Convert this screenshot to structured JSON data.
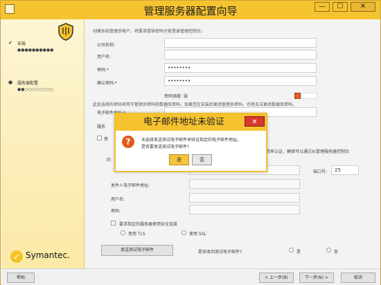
{
  "window": {
    "title": "管理服务器配置向导",
    "min_label": "—",
    "max_label": "☐",
    "close_label": "✕"
  },
  "sidebar": {
    "steps": [
      {
        "label": "安装",
        "mark": "✔",
        "dots": "●●●●●●●●●●"
      },
      {
        "label": "服务器配置",
        "mark": "●",
        "dots": "●●○○○○○○○○"
      }
    ],
    "logo_text": "Symantec."
  },
  "form": {
    "intro": "创建系统管理员帐户，将要求提供密码才能登录管理控制台。",
    "company_label": "公司名称:",
    "company_value": "",
    "username_label": "用户名:",
    "username_value": "",
    "password_label": "密码:*",
    "password_value": "••••••••",
    "confirm_label": "确认密码:*",
    "confirm_value": "••••••••",
    "strength_label": "密码强度: 弱",
    "note": "此处选择的密码将用于管理员密码和数据库密码。如果您在安装后更改管理员密码，也将无法更改数据库密码。",
    "email_label": "电子邮件地址:*",
    "server_label": "服务",
    "send_label": "使",
    "port_label": "端口号:",
    "port_value": "25",
    "sender_label": "发件人电子邮件地址:",
    "smtp_user_label": "用户名:",
    "smtp_pass_label": "密码:",
    "secure_label": "要求指定的服务器使用安全连接",
    "tls_label": "使用 TLS",
    "ssl_label": "使用 SSL",
    "test_button": "发送测试电子邮件",
    "received_question": "是否收到测试电子邮件?",
    "yes_label": "是",
    "no_label": "否",
    "side_text1": "用来认证，确保可以通过从管理服务器控制台",
    "side_text2": "的"
  },
  "bottom": {
    "help": "帮助",
    "back": "< 上一步(B)",
    "next": "下一步(N) >",
    "cancel": "取消"
  },
  "dialog": {
    "title": "电子邮件地址未验证",
    "close_label": "✕",
    "message_line1": "未选择发送测试电子邮件来验证指定的电子邮件地址。",
    "message_line2": "是否要发送测试电子邮件?",
    "yes_button": "是",
    "no_button": "否"
  },
  "colors": {
    "accent": "#f6c330",
    "close_red": "#d8372c",
    "warning": "#e25a1c"
  }
}
